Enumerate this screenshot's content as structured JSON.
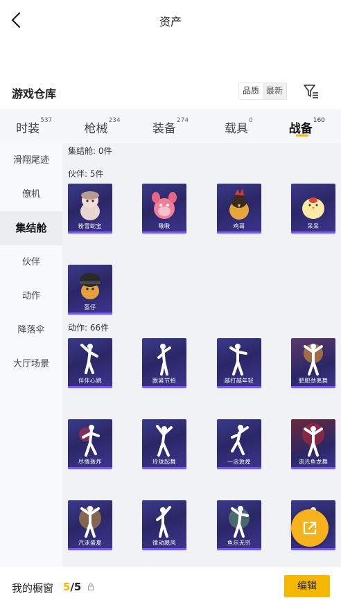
{
  "header": {
    "title": "资产"
  },
  "warehouse": {
    "title": "游戏仓库",
    "sort_options": [
      "品质",
      "最新"
    ]
  },
  "tabs": [
    {
      "label": "时装",
      "count": "537"
    },
    {
      "label": "枪械",
      "count": "234"
    },
    {
      "label": "装备",
      "count": "274"
    },
    {
      "label": "载具",
      "count": "0"
    },
    {
      "label": "战备",
      "count": "160"
    }
  ],
  "sidebar": {
    "items": [
      "滑翔尾迹",
      "僚机",
      "集结舱",
      "伙伴",
      "动作",
      "降落伞",
      "大厅场景"
    ]
  },
  "sections": {
    "capsule": "集结舱: 0件",
    "partner": "伙伴: 5件",
    "action": "动作: 66件"
  },
  "partners": [
    "粉雪蛇宝",
    "啾啾",
    "鸡哥",
    "呆呆",
    "盔仔"
  ],
  "actions": [
    "伴伴心跳",
    "跟紧节拍",
    "越打越年轻",
    "肥肥劲离舞",
    "尽情轰炸",
    "玲珑起舞",
    "一念敦煌",
    "流光鱼龙舞",
    "汽沫盛夏",
    "律动飓风",
    "鱼乐无穷",
    ""
  ],
  "bottom": {
    "label": "我的橱窗",
    "current": "5",
    "total": "/5",
    "edit": "编辑"
  },
  "colors": {
    "accent": "#f5b800",
    "card_bg": "#2b2766",
    "card_bar": "#7c5cf0"
  },
  "icons": {
    "back": "chevron-left-icon",
    "filter": "filter-icon",
    "share": "share-external-icon",
    "lock": "lock-icon"
  }
}
